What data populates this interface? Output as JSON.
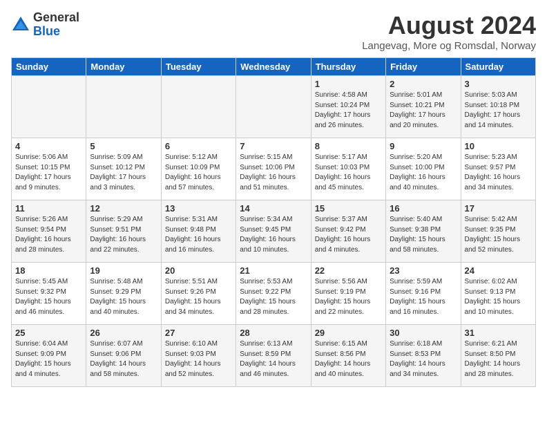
{
  "logo": {
    "general": "General",
    "blue": "Blue"
  },
  "title": "August 2024",
  "location": "Langevag, More og Romsdal, Norway",
  "days_of_week": [
    "Sunday",
    "Monday",
    "Tuesday",
    "Wednesday",
    "Thursday",
    "Friday",
    "Saturday"
  ],
  "weeks": [
    [
      {
        "day": "",
        "info": ""
      },
      {
        "day": "",
        "info": ""
      },
      {
        "day": "",
        "info": ""
      },
      {
        "day": "",
        "info": ""
      },
      {
        "day": "1",
        "info": "Sunrise: 4:58 AM\nSunset: 10:24 PM\nDaylight: 17 hours\nand 26 minutes."
      },
      {
        "day": "2",
        "info": "Sunrise: 5:01 AM\nSunset: 10:21 PM\nDaylight: 17 hours\nand 20 minutes."
      },
      {
        "day": "3",
        "info": "Sunrise: 5:03 AM\nSunset: 10:18 PM\nDaylight: 17 hours\nand 14 minutes."
      }
    ],
    [
      {
        "day": "4",
        "info": "Sunrise: 5:06 AM\nSunset: 10:15 PM\nDaylight: 17 hours\nand 9 minutes."
      },
      {
        "day": "5",
        "info": "Sunrise: 5:09 AM\nSunset: 10:12 PM\nDaylight: 17 hours\nand 3 minutes."
      },
      {
        "day": "6",
        "info": "Sunrise: 5:12 AM\nSunset: 10:09 PM\nDaylight: 16 hours\nand 57 minutes."
      },
      {
        "day": "7",
        "info": "Sunrise: 5:15 AM\nSunset: 10:06 PM\nDaylight: 16 hours\nand 51 minutes."
      },
      {
        "day": "8",
        "info": "Sunrise: 5:17 AM\nSunset: 10:03 PM\nDaylight: 16 hours\nand 45 minutes."
      },
      {
        "day": "9",
        "info": "Sunrise: 5:20 AM\nSunset: 10:00 PM\nDaylight: 16 hours\nand 40 minutes."
      },
      {
        "day": "10",
        "info": "Sunrise: 5:23 AM\nSunset: 9:57 PM\nDaylight: 16 hours\nand 34 minutes."
      }
    ],
    [
      {
        "day": "11",
        "info": "Sunrise: 5:26 AM\nSunset: 9:54 PM\nDaylight: 16 hours\nand 28 minutes."
      },
      {
        "day": "12",
        "info": "Sunrise: 5:29 AM\nSunset: 9:51 PM\nDaylight: 16 hours\nand 22 minutes."
      },
      {
        "day": "13",
        "info": "Sunrise: 5:31 AM\nSunset: 9:48 PM\nDaylight: 16 hours\nand 16 minutes."
      },
      {
        "day": "14",
        "info": "Sunrise: 5:34 AM\nSunset: 9:45 PM\nDaylight: 16 hours\nand 10 minutes."
      },
      {
        "day": "15",
        "info": "Sunrise: 5:37 AM\nSunset: 9:42 PM\nDaylight: 16 hours\nand 4 minutes."
      },
      {
        "day": "16",
        "info": "Sunrise: 5:40 AM\nSunset: 9:38 PM\nDaylight: 15 hours\nand 58 minutes."
      },
      {
        "day": "17",
        "info": "Sunrise: 5:42 AM\nSunset: 9:35 PM\nDaylight: 15 hours\nand 52 minutes."
      }
    ],
    [
      {
        "day": "18",
        "info": "Sunrise: 5:45 AM\nSunset: 9:32 PM\nDaylight: 15 hours\nand 46 minutes."
      },
      {
        "day": "19",
        "info": "Sunrise: 5:48 AM\nSunset: 9:29 PM\nDaylight: 15 hours\nand 40 minutes."
      },
      {
        "day": "20",
        "info": "Sunrise: 5:51 AM\nSunset: 9:26 PM\nDaylight: 15 hours\nand 34 minutes."
      },
      {
        "day": "21",
        "info": "Sunrise: 5:53 AM\nSunset: 9:22 PM\nDaylight: 15 hours\nand 28 minutes."
      },
      {
        "day": "22",
        "info": "Sunrise: 5:56 AM\nSunset: 9:19 PM\nDaylight: 15 hours\nand 22 minutes."
      },
      {
        "day": "23",
        "info": "Sunrise: 5:59 AM\nSunset: 9:16 PM\nDaylight: 15 hours\nand 16 minutes."
      },
      {
        "day": "24",
        "info": "Sunrise: 6:02 AM\nSunset: 9:13 PM\nDaylight: 15 hours\nand 10 minutes."
      }
    ],
    [
      {
        "day": "25",
        "info": "Sunrise: 6:04 AM\nSunset: 9:09 PM\nDaylight: 15 hours\nand 4 minutes."
      },
      {
        "day": "26",
        "info": "Sunrise: 6:07 AM\nSunset: 9:06 PM\nDaylight: 14 hours\nand 58 minutes."
      },
      {
        "day": "27",
        "info": "Sunrise: 6:10 AM\nSunset: 9:03 PM\nDaylight: 14 hours\nand 52 minutes."
      },
      {
        "day": "28",
        "info": "Sunrise: 6:13 AM\nSunset: 8:59 PM\nDaylight: 14 hours\nand 46 minutes."
      },
      {
        "day": "29",
        "info": "Sunrise: 6:15 AM\nSunset: 8:56 PM\nDaylight: 14 hours\nand 40 minutes."
      },
      {
        "day": "30",
        "info": "Sunrise: 6:18 AM\nSunset: 8:53 PM\nDaylight: 14 hours\nand 34 minutes."
      },
      {
        "day": "31",
        "info": "Sunrise: 6:21 AM\nSunset: 8:50 PM\nDaylight: 14 hours\nand 28 minutes."
      }
    ]
  ]
}
